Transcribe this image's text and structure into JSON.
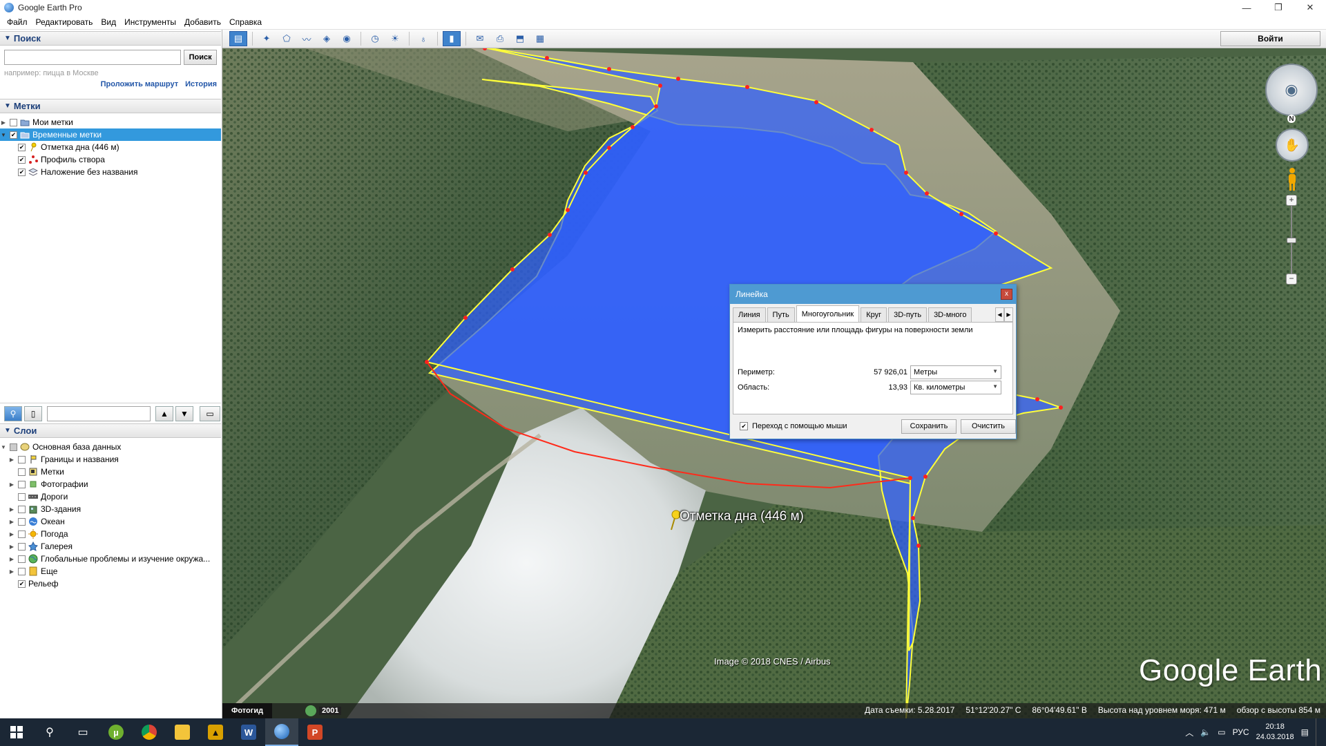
{
  "window": {
    "title": "Google Earth Pro",
    "min": "—",
    "max": "❐",
    "close": "✕"
  },
  "menu": [
    "Файл",
    "Редактировать",
    "Вид",
    "Инструменты",
    "Добавить",
    "Справка"
  ],
  "search": {
    "header": "Поиск",
    "placeholder": "",
    "button": "Поиск",
    "hint": "например: пицца в Москве",
    "link_route": "Проложить маршрут",
    "link_history": "История"
  },
  "places": {
    "header": "Метки",
    "items": [
      {
        "label": "Мои метки",
        "checked": false,
        "icon": "places-folder-icon"
      },
      {
        "label": "Временные метки",
        "checked": true,
        "icon": "temp-places-folder-icon"
      },
      {
        "label": "Отметка дна (446 м)",
        "checked": true,
        "icon": "yellow-pin-icon"
      },
      {
        "label": "Профиль створа",
        "checked": true,
        "icon": "path-icon"
      },
      {
        "label": "Наложение без названия",
        "checked": true,
        "icon": "overlay-icon"
      }
    ]
  },
  "layers": {
    "header": "Слои",
    "items": [
      {
        "label": "Основная база данных",
        "icon": "database-icon"
      },
      {
        "label": "Границы и названия",
        "icon": "borders-icon"
      },
      {
        "label": "Метки",
        "icon": "labels-icon"
      },
      {
        "label": "Фотографии",
        "icon": "photos-icon"
      },
      {
        "label": "Дороги",
        "icon": "roads-icon"
      },
      {
        "label": "3D-здания",
        "icon": "buildings-3d-icon"
      },
      {
        "label": "Океан",
        "icon": "ocean-icon"
      },
      {
        "label": "Погода",
        "icon": "weather-icon"
      },
      {
        "label": "Галерея",
        "icon": "gallery-icon"
      },
      {
        "label": "Глобальные проблемы и изучение окружа...",
        "icon": "global-awareness-icon"
      },
      {
        "label": "Еще",
        "icon": "more-icon"
      },
      {
        "label": "Рельеф",
        "icon": ""
      }
    ]
  },
  "toolbar": {
    "signin": "Войти"
  },
  "ruler": {
    "title": "Линейка",
    "close": "x",
    "tabs": [
      "Линия",
      "Путь",
      "Многоугольник",
      "Круг",
      "3D-путь",
      "3D-много"
    ],
    "active_tab": "Многоугольник",
    "description": "Измерить расстояние или площадь фигуры на поверхности земли",
    "perimeter_label": "Периметр:",
    "perimeter_value": "57 926,01",
    "perimeter_unit": "Метры",
    "area_label": "Область:",
    "area_value": "13,93",
    "area_unit": "Кв. километры",
    "mouse_nav": "Переход с помощью мыши",
    "save": "Сохранить",
    "clear": "Очистить"
  },
  "map": {
    "placemark_label": "Отметка дна (446 м)",
    "attribution": "Image © 2018 CNES / Airbus",
    "logo": "Google Earth",
    "north": "N",
    "polygon_fill": "#2f5fff",
    "polygon_edge": "#ffff3a",
    "profile_line": "#ff2a1a"
  },
  "statusbar": {
    "tour": "Фотогид",
    "year": "2001",
    "date": "Дата съемки: 5.28.2017",
    "lat": "51°12'20.27\" С",
    "lon": "86°04'49.61\" В",
    "elev": "Высота над уровнем моря:   471 м",
    "eye": "обзор с высоты   854 м"
  },
  "taskbar": {
    "lang": "РУС",
    "time": "20:18",
    "date": "24.03.2018"
  }
}
